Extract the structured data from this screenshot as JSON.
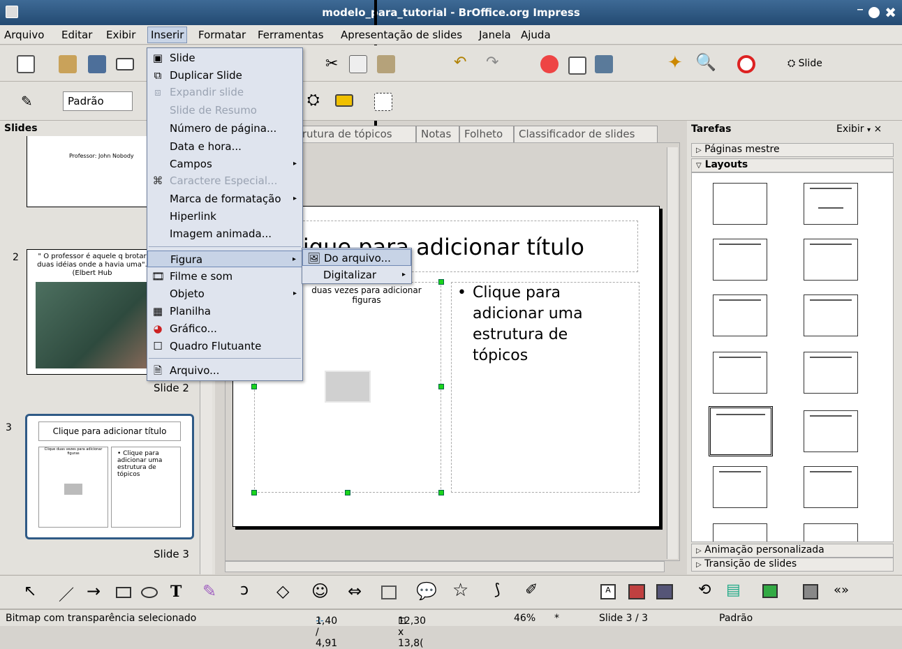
{
  "window": {
    "title": "modelo_para_tutorial - BrOffice.org Impress"
  },
  "menubar": [
    "Arquivo",
    "Editar",
    "Exibir",
    "Inserir",
    "Formatar",
    "Ferramentas",
    "Apresentação de slides",
    "Janela",
    "Ajuda"
  ],
  "toolbar2": {
    "style": "Padrão",
    "slide_button": "Slide"
  },
  "slides_panel": {
    "title": "Slides",
    "slide1_text": "Professor: John Nobody",
    "slide2_num": "2",
    "slide2_quote": "\" O professor é aquele q brotar duas idéias onde a havia uma\". (Elbert Hub",
    "slide2_label": "Slide 2",
    "slide3_num": "3",
    "slide3_title": "Clique para adicionar título",
    "slide3_left": "Clique duas vezes para adicionar figuras",
    "slide3_right": "• Clique para adicionar uma estrutura de tópicos",
    "slide3_label": "Slide 3"
  },
  "tabs": [
    "trutura de tópicos",
    "Notas",
    "Folheto",
    "Classificador de slides"
  ],
  "editor": {
    "title_placeholder": "lique para adicionar título",
    "figure_placeholder": "duas vezes para adicionar figuras",
    "outline_placeholder": "Clique para adicionar uma estrutura de tópicos"
  },
  "insert_menu": [
    {
      "label": "Slide",
      "icon": "slide-icon",
      "enabled": true
    },
    {
      "label": "Duplicar Slide",
      "icon": "duplicate-icon",
      "enabled": true
    },
    {
      "label": "Expandir slide",
      "icon": "expand-icon",
      "enabled": false
    },
    {
      "label": "Slide de Resumo",
      "enabled": false
    },
    {
      "label": "Número de página...",
      "enabled": true
    },
    {
      "label": "Data e hora...",
      "enabled": true
    },
    {
      "label": "Campos",
      "enabled": true,
      "submenu": true
    },
    {
      "label": "Caractere Especial...",
      "icon": "special-char-icon",
      "enabled": false
    },
    {
      "label": "Marca de formatação",
      "enabled": true,
      "submenu": true
    },
    {
      "label": "Hiperlink",
      "enabled": true
    },
    {
      "label": "Imagem animada...",
      "enabled": true
    },
    {
      "label": "Figura",
      "enabled": true,
      "submenu": true,
      "highlighted": true
    },
    {
      "label": "Filme e som",
      "icon": "movie-icon",
      "enabled": true
    },
    {
      "label": "Objeto",
      "enabled": true,
      "submenu": true
    },
    {
      "label": "Planilha",
      "icon": "spreadsheet-icon",
      "enabled": true
    },
    {
      "label": "Gráfico...",
      "icon": "chart-icon",
      "enabled": true
    },
    {
      "label": "Quadro Flutuante",
      "icon": "frame-icon",
      "enabled": true
    },
    {
      "label": "Arquivo...",
      "icon": "file-icon",
      "enabled": true
    }
  ],
  "figura_submenu": [
    {
      "label": "Do arquivo...",
      "highlighted": true
    },
    {
      "label": "Digitalizar",
      "submenu": true
    }
  ],
  "tasks_panel": {
    "title": "Tarefas",
    "view": "Exibir",
    "master_pages": "Páginas mestre",
    "layouts": "Layouts",
    "custom_anim": "Animação personalizada",
    "transition": "Transição de slides"
  },
  "statusbar": {
    "message": "Bitmap com transparência selecionado",
    "position": "1,40 / 4,91",
    "size": "12,30 x 13,8(",
    "zoom": "46%",
    "modified": "*",
    "slide": "Slide 3 / 3",
    "style": "Padrão"
  }
}
